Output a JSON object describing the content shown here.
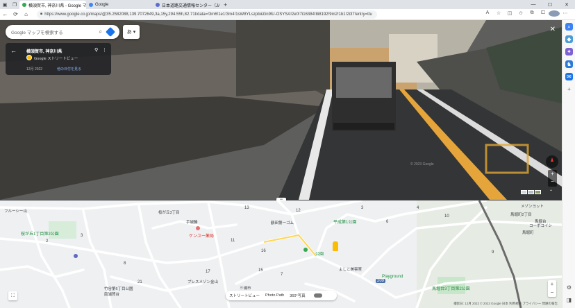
{
  "browser": {
    "tabs": [
      {
        "title": "横須賀市, 神奈川県 - Google マップ",
        "active": true,
        "favicon_color": "#34a853"
      },
      {
        "title": "Google",
        "active": false,
        "favicon_color": "#4285f4"
      },
      {
        "title": "日本道路交通情報センター（JARTIC）",
        "active": false,
        "favicon_color": "#5b6bd3"
      }
    ],
    "new_tab": "+",
    "window_controls": {
      "minimize": "—",
      "maximize": "☐",
      "close": "✕"
    },
    "url": "https://www.google.co.jp/maps/@35.2582088,139.7072649,3a,15y,294.55h,82.71t/data=!3m6!1e1!3m4!1sW8YLszpb&Gn9lU-OSYSA!2e0!7i16384!8i8192!9m2!1b1!2i37!entry=ttu"
  },
  "street_view": {
    "search_placeholder": "Google マップを検索する",
    "language_button": "あ ▾",
    "location_title": "横須賀市, 神奈川県",
    "source": "Google ストリートビュー",
    "capture_date": "12月 2022",
    "other_dates": "他の日付を見る",
    "watermark": "© 2023 Google",
    "close": "✕",
    "zoom_in": "+",
    "zoom_out": "−"
  },
  "map": {
    "labels": [
      {
        "text": "フルーシー山",
        "cls": "dark"
      },
      {
        "text": "桜が丘1丁目第2公園",
        "cls": "green"
      },
      {
        "text": "桜が丘3丁目",
        "cls": "dark"
      },
      {
        "text": "手城勝",
        "cls": "dark"
      },
      {
        "text": "ケンユー薬局",
        "cls": "red"
      },
      {
        "text": "プレスメゾン金山",
        "cls": "dark"
      },
      {
        "text": "鶴田第一ゴム",
        "cls": "dark"
      },
      {
        "text": "平成第1公園",
        "cls": "green"
      },
      {
        "text": "三浦市",
        "cls": "dark"
      },
      {
        "text": "公園",
        "cls": "green"
      },
      {
        "text": "よしこ美容室",
        "cls": "dark"
      },
      {
        "text": "Playground",
        "cls": "green"
      },
      {
        "text": "馬堀町",
        "cls": "dark"
      },
      {
        "text": "馬堀台3丁目第2公園",
        "cls": "green"
      },
      {
        "text": "メゾンヨット",
        "cls": "dark"
      },
      {
        "text": "竹谷第6丁目公園",
        "cls": "dark"
      },
      {
        "text": "南浦賀台",
        "cls": "dark"
      },
      {
        "text": "馬堀町2丁目",
        "cls": "dark"
      },
      {
        "text": "馬堀台",
        "cls": "dark"
      },
      {
        "text": "コーポコイシ",
        "cls": "dark"
      }
    ],
    "numbers": [
      "13",
      "12",
      "3",
      "2",
      "11",
      "21",
      "17",
      "15",
      "8",
      "16",
      "7",
      "6",
      "10",
      "9",
      "4",
      "3"
    ],
    "route_badge": "209",
    "layers": {
      "streetview": "ストリートビュー",
      "photo": "Photo Path",
      "view360": "360°写真"
    },
    "zoom_in": "+",
    "zoom_out": "−",
    "attribution": "撮影日: 12月 2022   © 2023 Google   日本   利用規約   プライバシー   問題の報告"
  }
}
